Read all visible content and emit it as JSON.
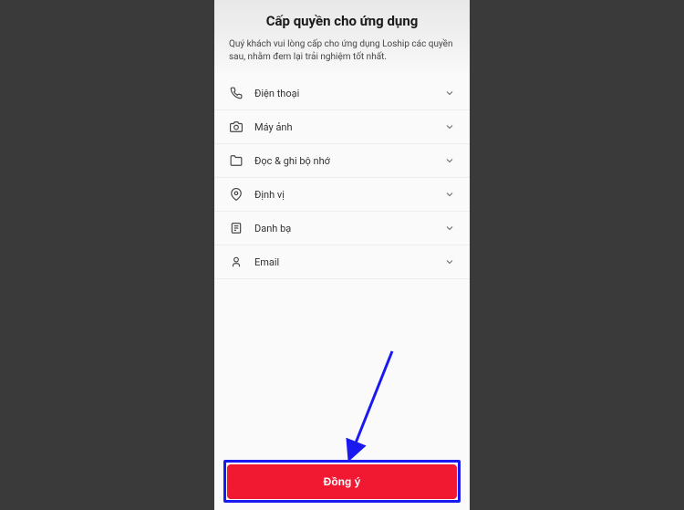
{
  "header": {
    "title": "Cấp quyền cho ứng dụng",
    "subtitle": "Quý khách vui lòng cấp cho ứng dụng Loship các quyền sau, nhằm đem lại trải nghiệm tốt nhất."
  },
  "permissions": [
    {
      "label": "Điện thoại",
      "icon": "phone"
    },
    {
      "label": "Máy ảnh",
      "icon": "camera"
    },
    {
      "label": "Đọc & ghi bộ nhớ",
      "icon": "folder"
    },
    {
      "label": "Định vị",
      "icon": "location"
    },
    {
      "label": "Danh bạ",
      "icon": "contacts"
    },
    {
      "label": "Email",
      "icon": "email"
    }
  ],
  "actions": {
    "agree_label": "Đồng ý"
  },
  "colors": {
    "primary": "#f01931",
    "highlight": "#1a1af0"
  }
}
